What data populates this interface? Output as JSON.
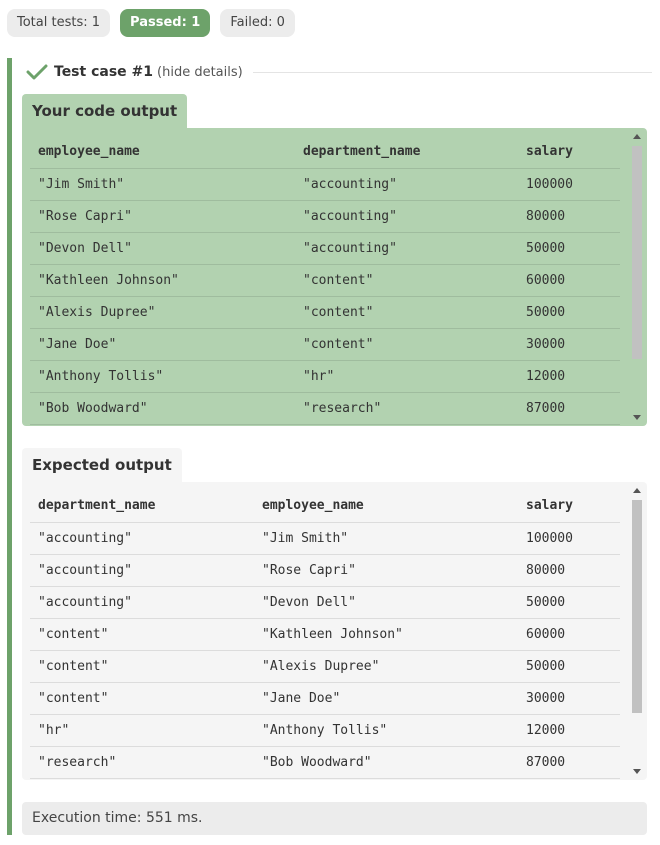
{
  "summary": {
    "total": "Total tests: 1",
    "passed": "Passed: 1",
    "failed": "Failed: 0"
  },
  "testcase": {
    "title": "Test case #1",
    "hide": "(hide details)",
    "status_color": "#6da26a"
  },
  "your_output": {
    "label": "Your code output",
    "headers": [
      "employee_name",
      "department_name",
      "salary"
    ],
    "rows": [
      [
        "\"Jim Smith\"",
        "\"accounting\"",
        "100000"
      ],
      [
        "\"Rose Capri\"",
        "\"accounting\"",
        "80000"
      ],
      [
        "\"Devon Dell\"",
        "\"accounting\"",
        "50000"
      ],
      [
        "\"Kathleen Johnson\"",
        "\"content\"",
        "60000"
      ],
      [
        "\"Alexis Dupree\"",
        "\"content\"",
        "50000"
      ],
      [
        "\"Jane Doe\"",
        "\"content\"",
        "30000"
      ],
      [
        "\"Anthony Tollis\"",
        "\"hr\"",
        "12000"
      ],
      [
        "\"Bob Woodward\"",
        "\"research\"",
        "87000"
      ]
    ]
  },
  "expected_output": {
    "label": "Expected output",
    "headers": [
      "department_name",
      "employee_name",
      "salary"
    ],
    "rows": [
      [
        "\"accounting\"",
        "\"Jim Smith\"",
        "100000"
      ],
      [
        "\"accounting\"",
        "\"Rose Capri\"",
        "80000"
      ],
      [
        "\"accounting\"",
        "\"Devon Dell\"",
        "50000"
      ],
      [
        "\"content\"",
        "\"Kathleen Johnson\"",
        "60000"
      ],
      [
        "\"content\"",
        "\"Alexis Dupree\"",
        "50000"
      ],
      [
        "\"content\"",
        "\"Jane Doe\"",
        "30000"
      ],
      [
        "\"hr\"",
        "\"Anthony Tollis\"",
        "12000"
      ],
      [
        "\"research\"",
        "\"Bob Woodward\"",
        "87000"
      ]
    ]
  },
  "execution": {
    "label": "Execution time: 551 ms."
  }
}
